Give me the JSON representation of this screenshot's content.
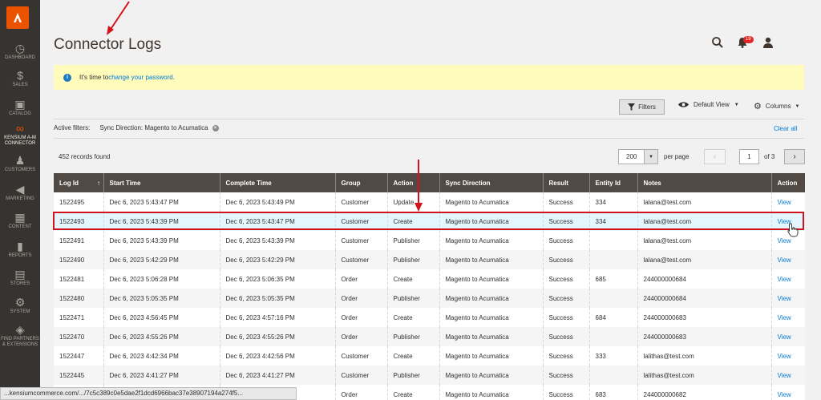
{
  "sidebar": {
    "items": [
      {
        "label": "DASHBOARD",
        "glyph": "◷"
      },
      {
        "label": "SALES",
        "glyph": "$"
      },
      {
        "label": "CATALOG",
        "glyph": "▣"
      },
      {
        "label": "KENSIUM A-M CONNECTOR",
        "glyph": "∞"
      },
      {
        "label": "CUSTOMERS",
        "glyph": "♟"
      },
      {
        "label": "MARKETING",
        "glyph": "◀"
      },
      {
        "label": "CONTENT",
        "glyph": "▦"
      },
      {
        "label": "REPORTS",
        "glyph": "▮"
      },
      {
        "label": "STORES",
        "glyph": "▤"
      },
      {
        "label": "SYSTEM",
        "glyph": "⚙"
      },
      {
        "label": "FIND PARTNERS & EXTENSIONS",
        "glyph": "◈"
      }
    ]
  },
  "header": {
    "title": "Connector Logs",
    "notification_count": "19"
  },
  "message": {
    "text_before": "It's time to ",
    "link": "change your password",
    "text_after": "."
  },
  "toolbar": {
    "filters_label": "Filters",
    "view_label": "Default View",
    "columns_label": "Columns"
  },
  "active_filters": {
    "label": "Active filters:",
    "chip": "Sync Direction: Magento to Acumatica",
    "clear_all": "Clear all"
  },
  "pagination": {
    "records_found": "452 records found",
    "per_page_value": "200",
    "per_page_label": "per page",
    "current_page": "1",
    "of_pages": "of 3"
  },
  "table": {
    "columns": [
      "Log Id",
      "Start Time",
      "Complete Time",
      "Group",
      "Action",
      "Sync Direction",
      "Result",
      "Entity Id",
      "Notes",
      "Action"
    ],
    "sort_indicator": "↑",
    "rows": [
      [
        "1522495",
        "Dec 6, 2023 5:43:47 PM",
        "Dec 6, 2023 5:43:49 PM",
        "Customer",
        "Update",
        "Magento to Acumatica",
        "Success",
        "334",
        "lalana@test.com",
        "View"
      ],
      [
        "1522493",
        "Dec 6, 2023 5:43:39 PM",
        "Dec 6, 2023 5:43:47 PM",
        "Customer",
        "Create",
        "Magento to Acumatica",
        "Success",
        "334",
        "lalana@test.com",
        "View"
      ],
      [
        "1522491",
        "Dec 6, 2023 5:43:39 PM",
        "Dec 6, 2023 5:43:39 PM",
        "Customer",
        "Publisher",
        "Magento to Acumatica",
        "Success",
        "",
        "lalana@test.com",
        "View"
      ],
      [
        "1522490",
        "Dec 6, 2023 5:42:29 PM",
        "Dec 6, 2023 5:42:29 PM",
        "Customer",
        "Publisher",
        "Magento to Acumatica",
        "Success",
        "",
        "lalana@test.com",
        "View"
      ],
      [
        "1522481",
        "Dec 6, 2023 5:06:28 PM",
        "Dec 6, 2023 5:06:35 PM",
        "Order",
        "Create",
        "Magento to Acumatica",
        "Success",
        "685",
        "244000000684",
        "View"
      ],
      [
        "1522480",
        "Dec 6, 2023 5:05:35 PM",
        "Dec 6, 2023 5:05:35 PM",
        "Order",
        "Publisher",
        "Magento to Acumatica",
        "Success",
        "",
        "244000000684",
        "View"
      ],
      [
        "1522471",
        "Dec 6, 2023 4:56:45 PM",
        "Dec 6, 2023 4:57:16 PM",
        "Order",
        "Create",
        "Magento to Acumatica",
        "Success",
        "684",
        "244000000683",
        "View"
      ],
      [
        "1522470",
        "Dec 6, 2023 4:55:26 PM",
        "Dec 6, 2023 4:55:26 PM",
        "Order",
        "Publisher",
        "Magento to Acumatica",
        "Success",
        "",
        "244000000683",
        "View"
      ],
      [
        "1522447",
        "Dec 6, 2023 4:42:34 PM",
        "Dec 6, 2023 4:42:56 PM",
        "Customer",
        "Create",
        "Magento to Acumatica",
        "Success",
        "333",
        "lalithas@test.com",
        "View"
      ],
      [
        "1522445",
        "Dec 6, 2023 4:41:27 PM",
        "Dec 6, 2023 4:41:27 PM",
        "Customer",
        "Publisher",
        "Magento to Acumatica",
        "Success",
        "",
        "lalithas@test.com",
        "View"
      ],
      [
        "",
        "",
        "7:56 AM",
        "Order",
        "Create",
        "Magento to Acumatica",
        "Success",
        "683",
        "244000000682",
        "View"
      ]
    ]
  },
  "statusbar": {
    "url": "...kensiumcommerce.com/.../7c5c389c0e5dae2f1dcd6966bac37e38907194a274f5..."
  }
}
